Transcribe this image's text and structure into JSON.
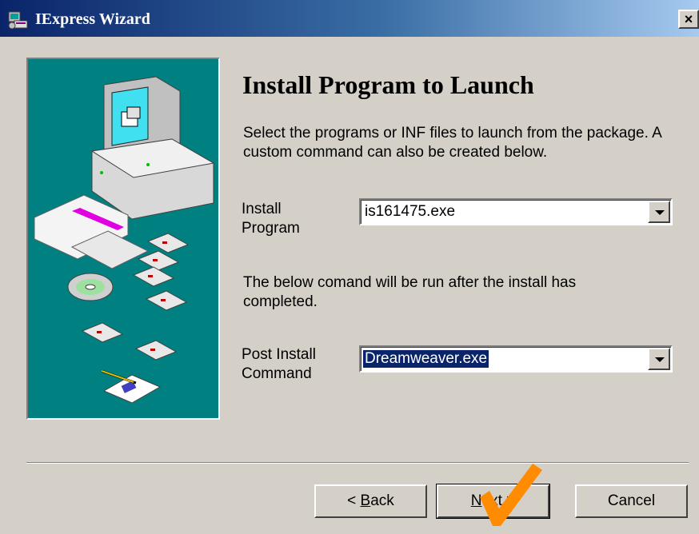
{
  "window": {
    "title": "IExpress Wizard",
    "close_label": "×"
  },
  "page": {
    "heading": "Install Program to Launch",
    "description": "Select the programs or INF files to launch from the package.  A custom command can also be created below.",
    "install_program": {
      "label_line1": "Install",
      "label_line2": "Program",
      "value": "is161475.exe"
    },
    "after_note": "The below comand will be run after the install has completed.",
    "post_install": {
      "label_line1": "Post Install",
      "label_line2": "Command",
      "value": "Dreamweaver.exe"
    }
  },
  "buttons": {
    "back_prefix": "< ",
    "back_accel": "B",
    "back_rest": "ack",
    "next_accel": "N",
    "next_rest": "ext >",
    "cancel": "Cancel"
  },
  "colors": {
    "titlebar_start": "#0a246a",
    "illustration_bg": "#008080",
    "dialog_bg": "#d4d0c8",
    "checkmark": "#ff8c00"
  }
}
